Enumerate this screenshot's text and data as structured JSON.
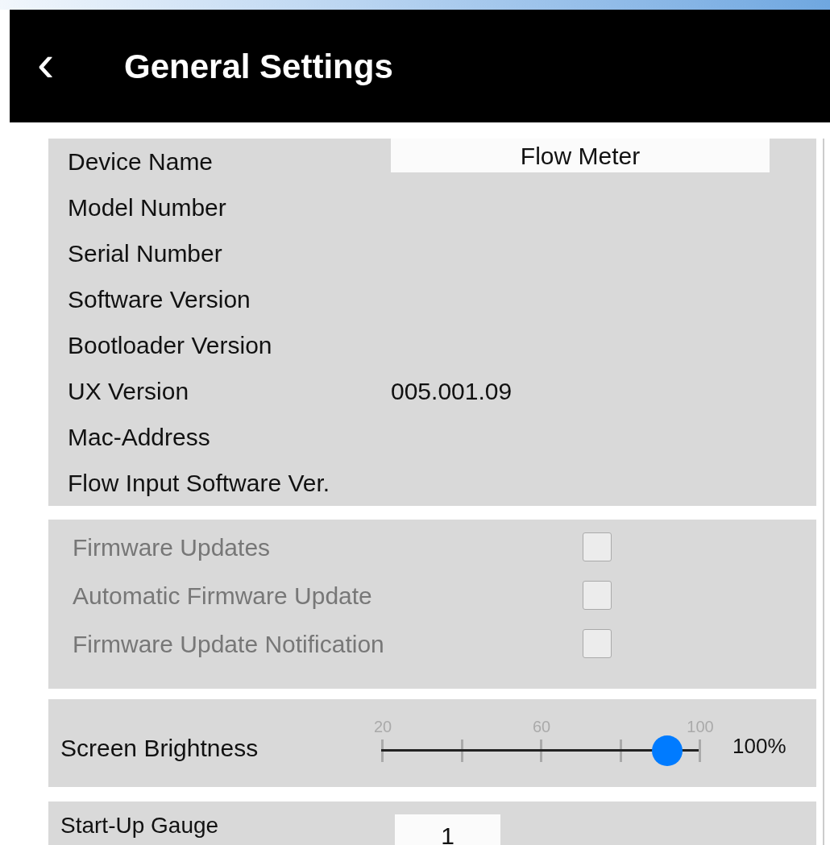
{
  "header": {
    "back": "‹",
    "title": "General Settings"
  },
  "info": [
    {
      "label": "Device Name",
      "value": "Flow Meter",
      "kind": "field"
    },
    {
      "label": "Model Number"
    },
    {
      "label": "Serial Number"
    },
    {
      "label": "Software Version"
    },
    {
      "label": "Bootloader Version"
    },
    {
      "label": "UX Version",
      "value": "005.001.09",
      "kind": "text"
    },
    {
      "label": "Mac-Address"
    },
    {
      "label": "Flow Input Software Ver."
    }
  ],
  "firmware": [
    {
      "label": "Firmware Updates",
      "checked": false,
      "disabled": true
    },
    {
      "label": "Automatic Firmware Update",
      "checked": false,
      "disabled": true
    },
    {
      "label": "Firmware Update Notification",
      "checked": false,
      "disabled": true
    }
  ],
  "brightness": {
    "label": "Screen Brightness",
    "tick_labels": [
      "20",
      "60",
      "100"
    ],
    "level": 0.9,
    "reading": "100%"
  },
  "startup_gauge": {
    "label": "Start-Up Gauge",
    "value": "1"
  }
}
